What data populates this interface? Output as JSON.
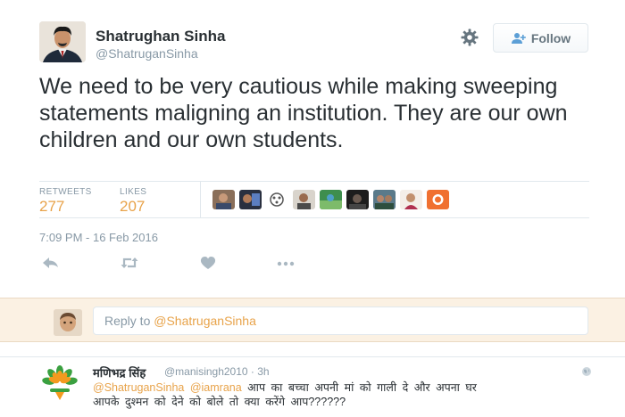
{
  "author": {
    "name": "Shatrughan Sinha",
    "handle": "@ShatruganSinha"
  },
  "follow_button": {
    "label": "Follow",
    "icon": "person-plus-icon"
  },
  "settings_icon": "gear-icon",
  "tweet_text": "We need to be very cautious while making sweeping statements maligning an institution. They are our own children and our own students.",
  "stats": {
    "retweets_label": "RETWEETS",
    "retweets": "277",
    "likes_label": "LIKES",
    "likes": "207"
  },
  "timestamp": "7:09 PM - 16 Feb 2016",
  "actions": [
    "reply-icon",
    "retweet-icon",
    "like-icon",
    "more-icon"
  ],
  "reply_box": {
    "prefix": "Reply to ",
    "mention": "@ShatruganSinha"
  },
  "reply": {
    "name": "मणिभद्र सिंह",
    "handle": "@manisingh2010 · 3h",
    "mention1": "@ShatruganSinha",
    "mention2": "@iamrana",
    "text_line1": "आप का बच्चा अपनी मां को गाली दे और अपना घर",
    "text_line2": "आपके दुश्मन को देने को बोले तो क्या करेंगे आप??????"
  },
  "colors": {
    "accent": "#e8a34a",
    "muted": "#8899a6",
    "text": "#292f33",
    "reply_bar_bg": "#fbf1e3"
  }
}
